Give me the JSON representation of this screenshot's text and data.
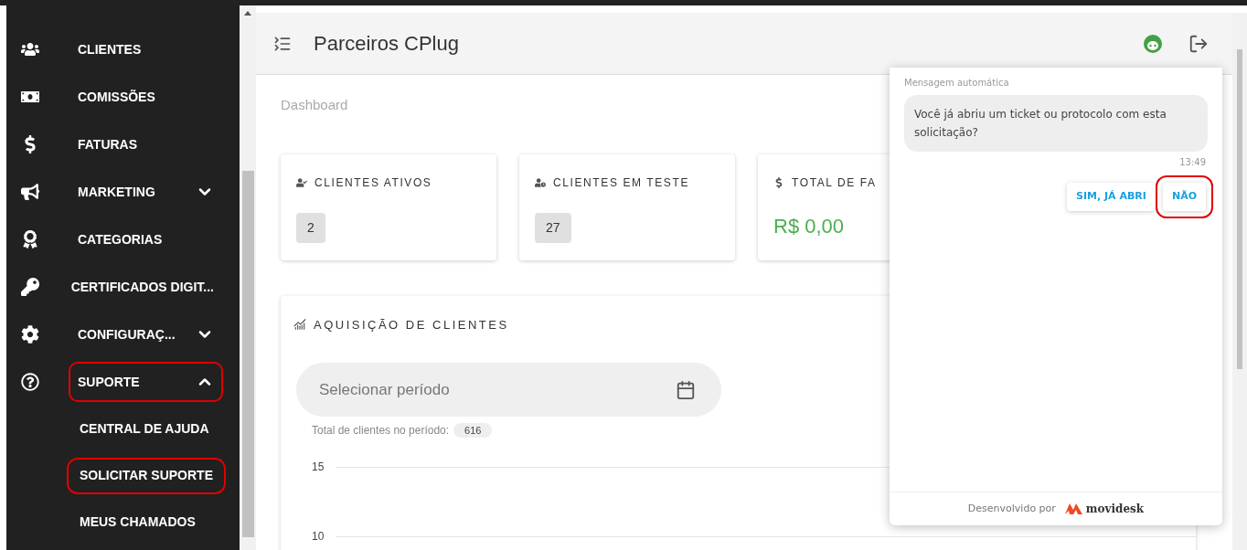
{
  "sidebar": {
    "items": [
      {
        "label": "CLIENTES",
        "highlighted": false
      },
      {
        "label": "COMISSÕES",
        "highlighted": false
      },
      {
        "label": "FATURAS",
        "highlighted": false
      },
      {
        "label": "MARKETING",
        "expanded": false,
        "highlighted": false
      },
      {
        "label": "CATEGORIAS",
        "highlighted": false
      },
      {
        "label": "CERTIFICADOS DIGIT...",
        "highlighted": false
      },
      {
        "label": "CONFIGURAÇ...",
        "expanded": false,
        "highlighted": false
      },
      {
        "label": "SUPORTE",
        "expanded": true,
        "highlighted": true,
        "children": [
          {
            "label": "CENTRAL DE AJUDA",
            "highlighted": false
          },
          {
            "label": "SOLICITAR SUPORTE",
            "highlighted": true
          },
          {
            "label": "MEUS CHAMADOS",
            "highlighted": false
          }
        ]
      }
    ]
  },
  "header": {
    "title": "Parceiros CPlug"
  },
  "breadcrumb": "Dashboard",
  "cards": [
    {
      "kind": "badge",
      "title": "CLIENTES ATIVOS",
      "value": "2"
    },
    {
      "kind": "badge",
      "title": "CLIENTES EM TESTE",
      "value": "27"
    },
    {
      "kind": "money",
      "title": "TOTAL DE FA",
      "value": "R$ 0,00"
    }
  ],
  "acquisition": {
    "title": "AQUISIÇÃO DE CLIENTES",
    "period_field": {
      "placeholder": "Selecionar período"
    },
    "total_label": "Total de clientes no período:",
    "total_value": "616",
    "y_ticks": [
      "15",
      "10"
    ]
  },
  "chat": {
    "sender": "Mensagem automática",
    "message": "Você já abriu um ticket ou protocolo com esta solicitação?",
    "time": "13:49",
    "options": [
      {
        "label": "SIM, JÁ ABRI",
        "highlighted": false
      },
      {
        "label": "NÃO",
        "highlighted": true
      }
    ],
    "footer": "Desenvolvido por",
    "brand": "movidesk"
  }
}
